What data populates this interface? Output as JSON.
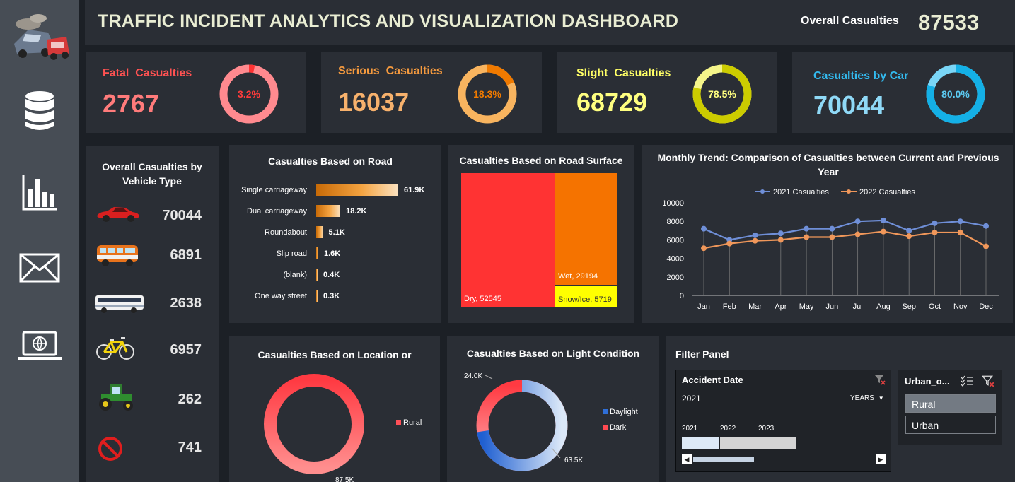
{
  "title": "TRAFFIC INCIDENT ANALYTICS AND VISUALIZATION DASHBOARD",
  "overall": {
    "label": "Overall Casualties",
    "value": "87533"
  },
  "sidebar": {
    "items": [
      {
        "icon": "database-icon"
      },
      {
        "icon": "bar-chart-icon"
      },
      {
        "icon": "mail-icon"
      },
      {
        "icon": "laptop-globe-icon"
      }
    ]
  },
  "kpis": [
    {
      "label": "Fatal  Casualties",
      "value": "2767",
      "pct": "3.2%",
      "fraction": 0.032,
      "color": "#ff5252",
      "ring": "#ff7f86",
      "ring_hi": "#ff3b3b"
    },
    {
      "label": "Serious  Casualties",
      "value": "16037",
      "pct": "18.3%",
      "fraction": 0.183,
      "color": "#f59a3e",
      "ring": "#f7b160",
      "ring_hi": "#f07a00"
    },
    {
      "label": "Slight  Casualties",
      "value": "68729",
      "pct": "78.5%",
      "fraction": 0.785,
      "color": "#ffff66",
      "ring": "#c8c800",
      "ring_hi": "#f5f58a"
    },
    {
      "label": "Casualties by Car",
      "value": "70044",
      "pct": "80.0%",
      "fraction": 0.8,
      "color": "#33bbf0",
      "ring": "#18b4e8",
      "ring_hi": "#7ad6f7"
    }
  ],
  "vehicle": {
    "title": "Overall  Casualties by Vehicle Type",
    "items": [
      {
        "icon": "car-icon",
        "value": "70044"
      },
      {
        "icon": "van-icon",
        "value": "6891"
      },
      {
        "icon": "bus-icon",
        "value": "2638"
      },
      {
        "icon": "bicycle-icon",
        "value": "6957"
      },
      {
        "icon": "tractor-icon",
        "value": "262"
      },
      {
        "icon": "no-entry-icon",
        "value": "741"
      }
    ]
  },
  "road": {
    "title": "Casualties Based on Road",
    "rows": [
      {
        "label": "Single carriageway",
        "value": 61.9,
        "text": "61.9K"
      },
      {
        "label": "Dual carriageway",
        "value": 18.2,
        "text": "18.2K"
      },
      {
        "label": "Roundabout",
        "value": 5.1,
        "text": "5.1K"
      },
      {
        "label": "Slip road",
        "value": 1.6,
        "text": "1.6K"
      },
      {
        "label": "(blank)",
        "value": 0.4,
        "text": "0.4K"
      },
      {
        "label": "One way street",
        "value": 0.3,
        "text": "0.3K"
      }
    ]
  },
  "surface": {
    "title": "Casualties Based on Road Surface",
    "dry_label": "Dry, 52545",
    "wet_label": "Wet, 29194",
    "snow_label": "Snow/Ice, 5719"
  },
  "chart_data": {
    "type": "line",
    "title": "Monthly Trend: Comparison of Casualties between Current and Previous Year",
    "categories": [
      "Jan",
      "Feb",
      "Mar",
      "Apr",
      "May",
      "Jun",
      "Jul",
      "Aug",
      "Sep",
      "Oct",
      "Nov",
      "Dec"
    ],
    "series": [
      {
        "name": "2021 Casualties",
        "color": "#6f8fd8",
        "values": [
          7200,
          6000,
          6500,
          6700,
          7200,
          7200,
          8000,
          8100,
          7000,
          7800,
          8000,
          7500
        ]
      },
      {
        "name": "2022 Casualties",
        "color": "#f0975a",
        "values": [
          5100,
          5600,
          5900,
          6000,
          6300,
          6300,
          6600,
          6900,
          6400,
          6800,
          6800,
          5300
        ]
      }
    ],
    "yticks": [
      "10000",
      "8000",
      "6000",
      "4000",
      "2000",
      "0"
    ],
    "ylim": [
      0,
      10000
    ],
    "legend": "top"
  },
  "location": {
    "title": "Casualties Based on Location or",
    "legend": "Rural",
    "value_label": "87.5K"
  },
  "light": {
    "title": "Casualties Based on Light Condition",
    "legend_day": "Daylight",
    "legend_dark": "Dark",
    "day_value": "63.5K",
    "dark_value": "24.0K",
    "day": 63.5,
    "dark": 24.0
  },
  "filter": {
    "title": "Filter Panel",
    "date_title": "Accident Date",
    "date_value": "2021",
    "years_label": "YEARS",
    "years": [
      "2021",
      "2022",
      "2023"
    ],
    "urban_title": "Urban_o...",
    "options": [
      "Rural",
      "Urban"
    ]
  }
}
